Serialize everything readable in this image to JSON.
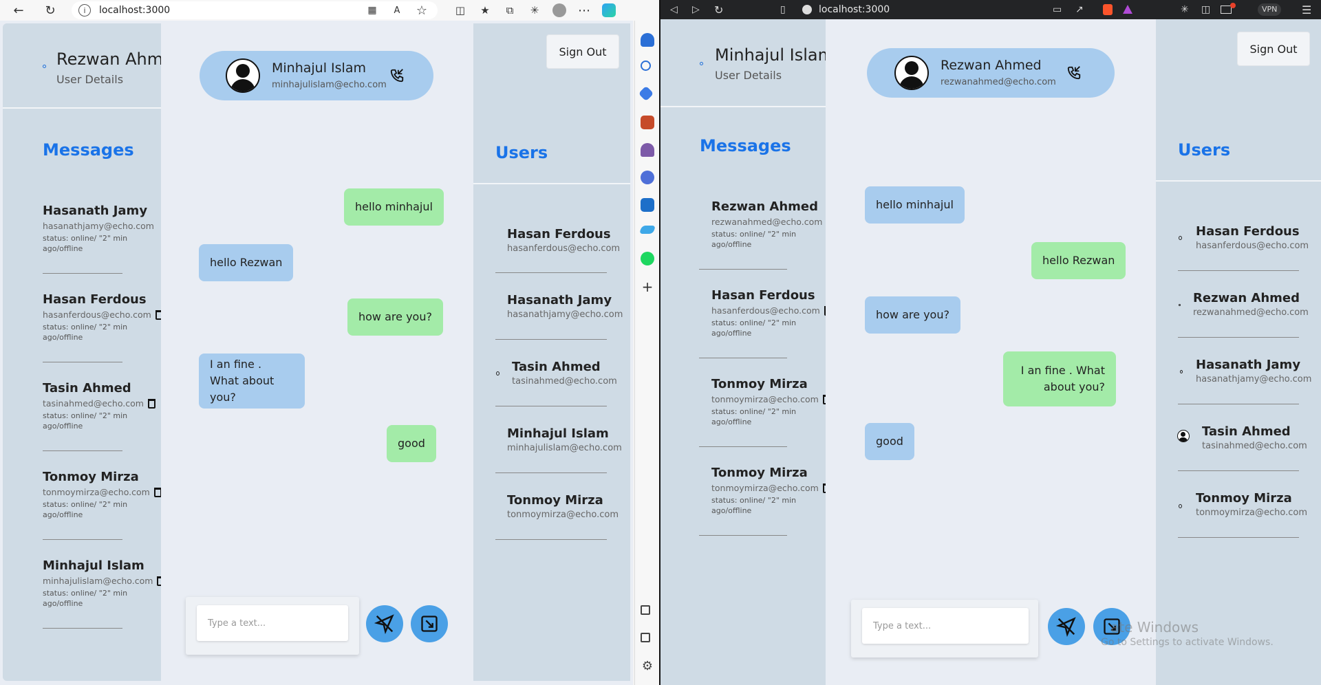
{
  "left_window": {
    "url": "localhost:3000",
    "current_user": {
      "name": "Rezwan Ahme",
      "subtitle": "User Details"
    },
    "messages_title": "Messages",
    "messages": [
      {
        "name": "Hasanath Jamy",
        "email": "hasanathjamy@echo.com",
        "status": "status: online/ \"2\" min ago/offline"
      },
      {
        "name": "Hasan Ferdous",
        "email": "hasanferdous@echo.com",
        "status": "status: online/ \"2\" min ago/offline"
      },
      {
        "name": "Tasin Ahmed",
        "email": "tasinahmed@echo.com",
        "status": "status: online/ \"2\" min ago/offline"
      },
      {
        "name": "Tonmoy Mirza",
        "email": "tonmoymirza@echo.com",
        "status": "status: online/ \"2\" min ago/offline"
      },
      {
        "name": "Minhajul Islam",
        "email": "minhajulislam@echo.com",
        "status": "status: online/ \"2\" min ago/offline"
      }
    ],
    "chat_with": {
      "name": "Minhajul Islam",
      "email": "minhajulislam@echo.com"
    },
    "chat": [
      {
        "text": "hello minhajul",
        "dir": "sent"
      },
      {
        "text": "hello Rezwan",
        "dir": "recv"
      },
      {
        "text": "how are you?",
        "dir": "sent"
      },
      {
        "text": "I an fine . What about you?",
        "dir": "recv"
      },
      {
        "text": "good",
        "dir": "sent"
      }
    ],
    "input_placeholder": "Type a text...",
    "sign_out": "Sign Out",
    "users_title": "Users",
    "users": [
      {
        "name": "Hasan Ferdous",
        "email": "hasanferdous@echo.com"
      },
      {
        "name": "Hasanath Jamy",
        "email": "hasanathjamy@echo.com"
      },
      {
        "name": "Tasin Ahmed",
        "email": "tasinahmed@echo.com"
      },
      {
        "name": "Minhajul Islam",
        "email": "minhajulislam@echo.com"
      },
      {
        "name": "Tonmoy Mirza",
        "email": "tonmoymirza@echo.com"
      }
    ]
  },
  "right_window": {
    "url": "localhost:3000",
    "vpn": "VPN",
    "current_user": {
      "name": "Minhajul Islam",
      "subtitle": "User Details"
    },
    "messages_title": "Messages",
    "messages": [
      {
        "name": "Rezwan Ahmed",
        "email": "rezwanahmed@echo.com",
        "status": "status: online/ \"2\" min ago/offline"
      },
      {
        "name": "Hasan Ferdous",
        "email": "hasanferdous@echo.com",
        "status": "status: online/ \"2\" min ago/offline"
      },
      {
        "name": "Tonmoy Mirza",
        "email": "tonmoymirza@echo.com",
        "status": "status: online/ \"2\" min ago/offline"
      },
      {
        "name": "Tonmoy Mirza",
        "email": "tonmoymirza@echo.com",
        "status": "status: online/ \"2\" min ago/offline"
      }
    ],
    "chat_with": {
      "name": "Rezwan Ahmed",
      "email": "rezwanahmed@echo.com"
    },
    "chat": [
      {
        "text": "hello minhajul",
        "dir": "recv"
      },
      {
        "text": "hello Rezwan",
        "dir": "sent"
      },
      {
        "text": "how are you?",
        "dir": "recv"
      },
      {
        "text": "I an fine . What about you?",
        "dir": "sent"
      },
      {
        "text": "good",
        "dir": "recv"
      }
    ],
    "input_placeholder": "Type a text...",
    "sign_out": "Sign Out",
    "users_title": "Users",
    "users": [
      {
        "name": "Hasan Ferdous",
        "email": "hasanferdous@echo.com"
      },
      {
        "name": "Rezwan Ahmed",
        "email": "rezwanahmed@echo.com"
      },
      {
        "name": "Hasanath Jamy",
        "email": "hasanathjamy@echo.com"
      },
      {
        "name": "Tasin Ahmed",
        "email": "tasinahmed@echo.com"
      },
      {
        "name": "Tonmoy Mirza",
        "email": "tonmoymirza@echo.com"
      }
    ],
    "watermark_title": "ate Windows",
    "watermark_sub": "Go to Settings to activate Windows."
  },
  "colors": {
    "panel": "#cfdbe5",
    "chat_bg": "#e9edf4",
    "sent_bubble": "#a3eba8",
    "recv_bubble": "#a8ccee",
    "accent": "#1a73e8",
    "action_button": "#4aa0e6"
  },
  "icons": [
    "back-icon",
    "reload-icon",
    "info-icon",
    "phone-icon",
    "send-icon",
    "attach-icon",
    "trash-icon",
    "avatar-icon",
    "bell-icon",
    "search-icon",
    "gear-icon"
  ]
}
